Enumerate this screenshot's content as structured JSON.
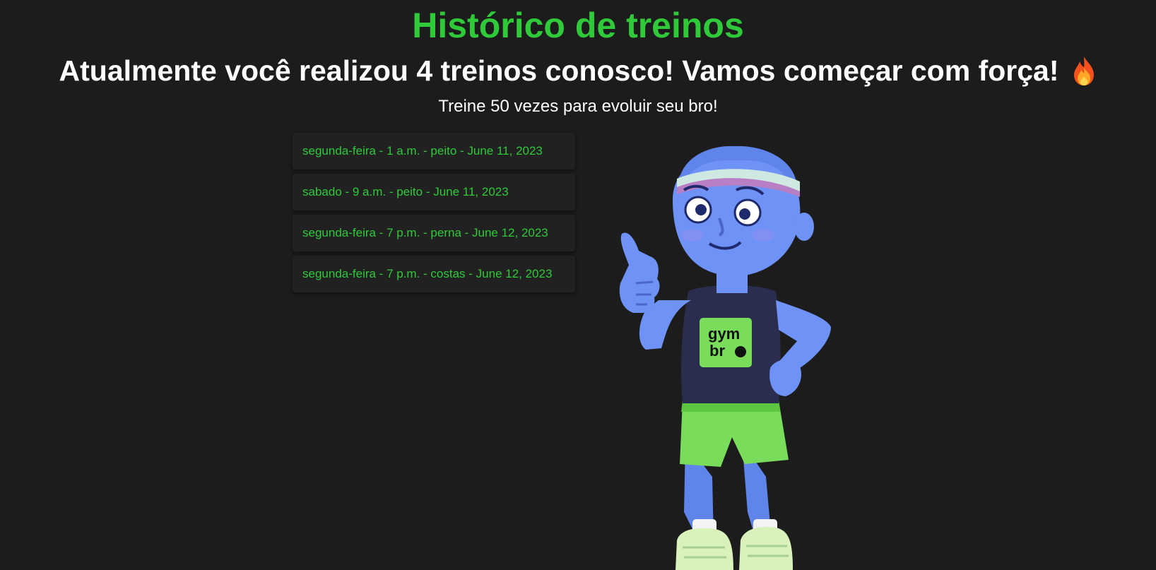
{
  "page": {
    "title": "Histórico de treinos",
    "headline": "Atualmente você realizou 4 treinos conosco! Vamos começar com força!",
    "headline_icon": "fire-icon",
    "subtitle": "Treine 50 vezes para evoluir seu bro!"
  },
  "workouts": [
    {
      "label": "segunda-feira - 1 a.m. - peito - June 11, 2023"
    },
    {
      "label": "sabado - 9 a.m. - peito - June 11, 2023"
    },
    {
      "label": "segunda-feira - 7 p.m. - perna - June 12, 2023"
    },
    {
      "label": "segunda-feira - 7 p.m. - costas - June 12, 2023"
    }
  ],
  "mascot": {
    "shirt_text_line1": "gym",
    "shirt_text_line2": "br"
  },
  "colors": {
    "background": "#1c1c1c",
    "accent": "#2fc93a",
    "card": "#212121",
    "mascot_skin": "#6e92f5",
    "mascot_shorts": "#79dc5a",
    "mascot_shirt": "#2b2d4e"
  }
}
